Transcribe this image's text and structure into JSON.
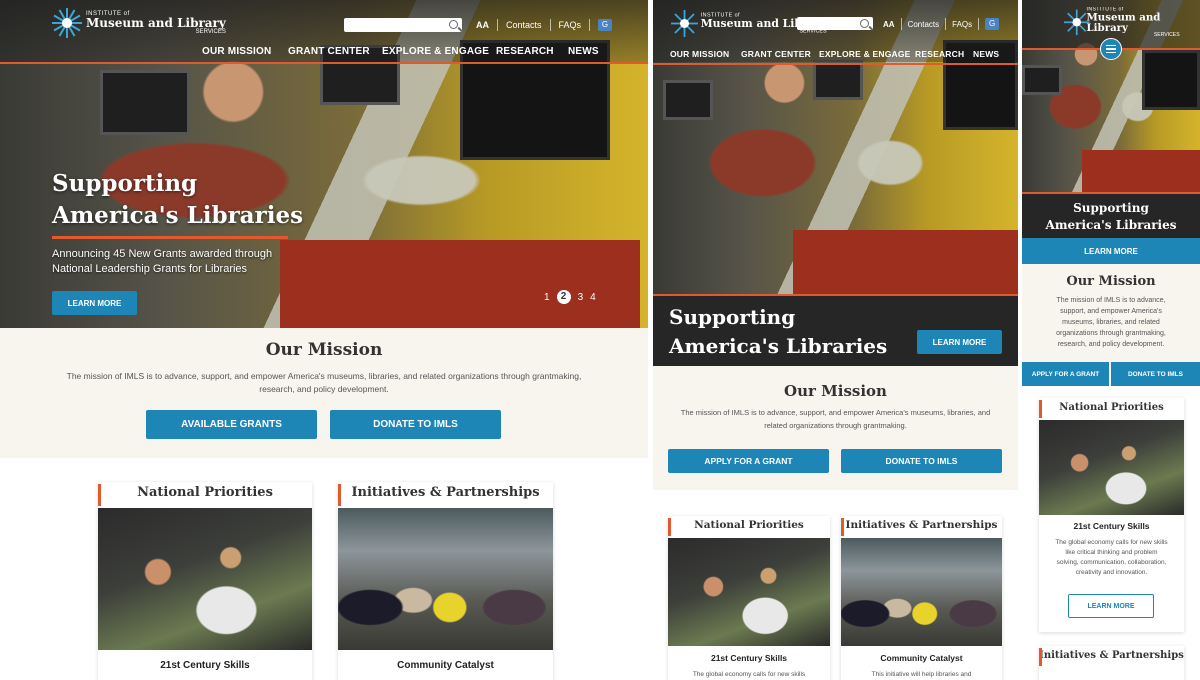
{
  "brand": {
    "line1": "INSTITUTE of",
    "line2": "Museum and Library",
    "line3": "SERVICES"
  },
  "utility": {
    "text_size": "AA",
    "contacts": "Contacts",
    "faqs": "FAQs",
    "translate_icon": "translate-icon"
  },
  "nav": {
    "items": [
      "OUR MISSION",
      "GRANT CENTER",
      "EXPLORE & ENGAGE",
      "RESEARCH",
      "NEWS"
    ]
  },
  "desktop": {
    "hero": {
      "title_line1": "Supporting",
      "title_line2": "America's Libraries",
      "subtitle_line1": "Announcing 45 New Grants awarded through",
      "subtitle_line2": "National Leadership Grants for Libraries",
      "cta": "LEARN MORE",
      "slides": [
        "1",
        "2",
        "3",
        "4"
      ],
      "active_slide": "2"
    },
    "mission": {
      "title": "Our Mission",
      "text_line1": "The mission of IMLS is to advance, support, and empower America's museums, libraries, and related organizations through grantmaking,",
      "text_line2": "research, and policy development.",
      "btn_primary": "AVAILABLE GRANTS",
      "btn_secondary": "DONATE TO IMLS"
    },
    "cards": [
      {
        "title": "National Priorities",
        "caption": "21st Century Skills"
      },
      {
        "title": "Initiatives & Partnerships",
        "caption": "Community Catalyst"
      }
    ]
  },
  "tablet": {
    "hero": {
      "title_line1": "Supporting",
      "title_line2": "America's Libraries",
      "cta": "LEARN MORE"
    },
    "mission": {
      "title": "Our Mission",
      "text_line1": "The mission of IMLS is to advance, support, and empower America's museums, libraries, and",
      "text_line2": "related organizations through grantmaking.",
      "btn_primary": "APPLY FOR A GRANT",
      "btn_secondary": "DONATE TO IMLS"
    },
    "cards": [
      {
        "title": "National Priorities",
        "caption": "21st Century Skills",
        "desc": "The global economy calls for new skills"
      },
      {
        "title": "Initiatives & Partnerships",
        "caption": "Community Catalyst",
        "desc": "This initiative will help libraries and"
      }
    ]
  },
  "mobile": {
    "hero": {
      "title_line1": "Supporting",
      "title_line2": "America's Libraries",
      "cta": "LEARN MORE"
    },
    "mission": {
      "title": "Our Mission",
      "text_line1": "The mission of IMLS is to advance,",
      "text_line2": "support, and empower America's",
      "text_line3": "museums, libraries, and related",
      "text_line4": "organizations through grantmaking,",
      "text_line5": "research, and policy development.",
      "btn_primary": "APPLY FOR A GRANT",
      "btn_secondary": "DONATE TO IMLS"
    },
    "card": {
      "title": "National Priorities",
      "caption": "21st Century Skills",
      "desc_line1": "The global economy calls for new skills",
      "desc_line2": "like critical thinking and problem",
      "desc_line3": "solving, communication, collaboration,",
      "desc_line4": "creativity and innovation.",
      "cta": "LEARN MORE"
    },
    "next_card_title": "Initiatives & Partnerships"
  },
  "colors": {
    "accent": "#e1592c",
    "primary": "#1e86b7",
    "mission_bg": "#f8f5ee"
  }
}
